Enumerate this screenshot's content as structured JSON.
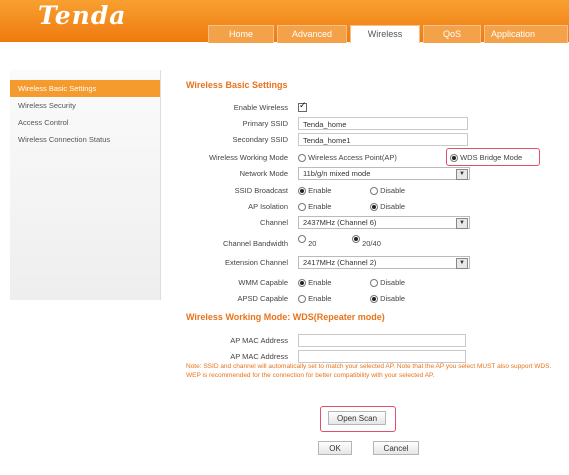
{
  "header": {
    "logo": "Tenda",
    "tabs": [
      "Home",
      "Advanced",
      "Wireless",
      "QoS",
      "Application"
    ],
    "active_tab": "Wireless"
  },
  "sidebar": {
    "items": [
      {
        "label": "Wireless Basic Settings",
        "active": true
      },
      {
        "label": "Wireless Security",
        "active": false
      },
      {
        "label": "Access Control",
        "active": false
      },
      {
        "label": "Wireless Connection Status",
        "active": false
      }
    ]
  },
  "basic": {
    "title": "Wireless Basic Settings",
    "enable_wireless_label": "Enable Wireless",
    "enable_wireless": true,
    "primary_ssid_label": "Primary SSID",
    "primary_ssid": "Tenda_home",
    "secondary_ssid_label": "Secondary SSID",
    "secondary_ssid": "Tenda_home1",
    "working_mode_label": "Wireless Working Mode",
    "working_mode_options": [
      "Wireless Access Point(AP)",
      "WDS Bridge Mode"
    ],
    "working_mode_selected": "WDS Bridge Mode",
    "network_mode_label": "Network Mode",
    "network_mode": "11b/g/n mixed mode",
    "ssid_broadcast_label": "SSID Broadcast",
    "enable": "Enable",
    "disable": "Disable",
    "ssid_broadcast": "Enable",
    "ap_isolation_label": "AP Isolation",
    "ap_isolation": "Disable",
    "channel_label": "Channel",
    "channel": "2437MHz (Channel 6)",
    "bandwidth_label": "Channel Bandwidth",
    "bandwidth_options": [
      "20",
      "20/40"
    ],
    "bandwidth": "20/40",
    "ext_channel_label": "Extension Channel",
    "ext_channel": "2417MHz (Channel 2)",
    "wmm_label": "WMM Capable",
    "wmm": "Enable",
    "apsd_label": "APSD Capable",
    "apsd": "Disable"
  },
  "wds": {
    "title": "Wireless Working Mode: WDS(Repeater mode)",
    "ap_mac_label_1": "AP MAC Address",
    "ap_mac_1": "",
    "ap_mac_label_2": "AP MAC Address",
    "ap_mac_2": "",
    "note": "Note: SSID and channel will automatically set to match your selected AP. Note that the AP you select MUST also support WDS. WEP is recommended for the connection for better compatibility with your selected AP.",
    "open_scan": "Open Scan",
    "ok": "OK",
    "cancel": "Cancel"
  },
  "colors": {
    "accent": "#f07a10",
    "highlight": "#e0506a"
  }
}
